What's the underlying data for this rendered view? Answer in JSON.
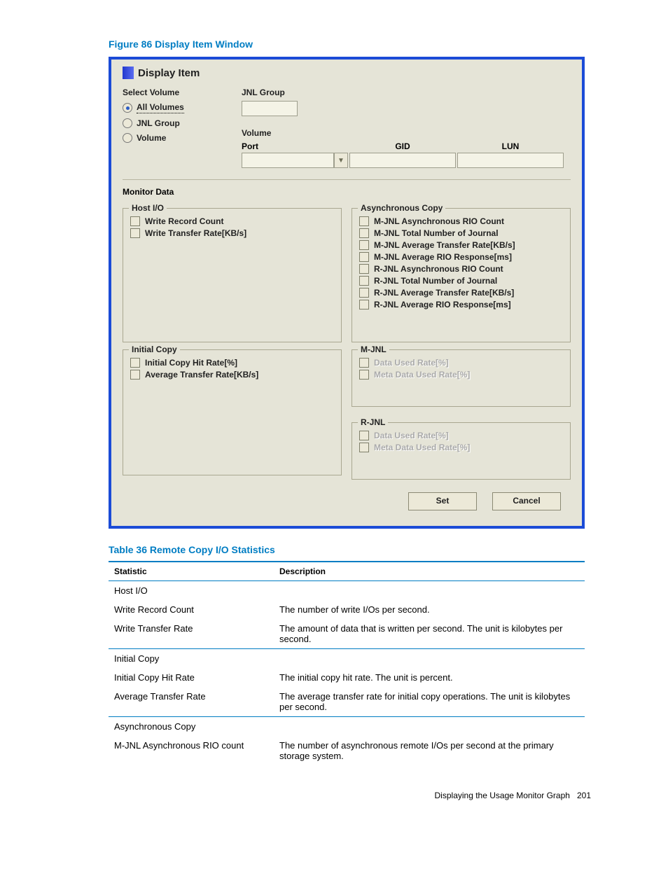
{
  "figure_title": "Figure 86 Display Item Window",
  "window": {
    "header": "Display Item",
    "select_volume_label": "Select Volume",
    "radio_all": "All Volumes",
    "radio_jnl": "JNL Group",
    "radio_vol": "Volume",
    "jnl_group_label": "JNL Group",
    "volume_label": "Volume",
    "port_label": "Port",
    "gid_label": "GID",
    "lun_label": "LUN",
    "monitor_label": "Monitor Data",
    "host_io": {
      "legend": "Host I/O",
      "items": [
        "Write Record Count",
        "Write Transfer Rate[KB/s]"
      ]
    },
    "async": {
      "legend": "Asynchronous Copy",
      "items": [
        "M-JNL Asynchronous RIO Count",
        "M-JNL Total Number of Journal",
        "M-JNL Average Transfer Rate[KB/s]",
        "M-JNL Average RIO Response[ms]",
        "R-JNL Asynchronous RIO Count",
        "R-JNL Total Number of Journal",
        "R-JNL Average Transfer Rate[KB/s]",
        "R-JNL Average RIO Response[ms]"
      ]
    },
    "initial": {
      "legend": "Initial Copy",
      "items": [
        "Initial Copy Hit Rate[%]",
        "Average Transfer Rate[KB/s]"
      ]
    },
    "mjnl": {
      "legend": "M-JNL",
      "items": [
        "Data Used Rate[%]",
        "Meta Data Used Rate[%]"
      ]
    },
    "rjnl": {
      "legend": "R-JNL",
      "items": [
        "Data Used Rate[%]",
        "Meta Data Used Rate[%]"
      ]
    },
    "set_btn": "Set",
    "cancel_btn": "Cancel"
  },
  "table_title": "Table 36 Remote Copy I/O Statistics",
  "table": {
    "col1": "Statistic",
    "col2": "Description",
    "rows": [
      {
        "s": "Host I/O",
        "d": "",
        "grp": true
      },
      {
        "s": "Write Record Count",
        "d": "The number of write I/Os per second."
      },
      {
        "s": "Write Transfer Rate",
        "d": "The amount of data that is written per second. The unit is kilobytes per second."
      },
      {
        "s": "Initial Copy",
        "d": "",
        "grp": true
      },
      {
        "s": "Initial Copy Hit Rate",
        "d": "The initial copy hit rate. The unit is percent."
      },
      {
        "s": "Average Transfer Rate",
        "d": "The average transfer rate for initial copy operations. The unit is kilobytes per second."
      },
      {
        "s": "Asynchronous Copy",
        "d": "",
        "grp": true
      },
      {
        "s": "M-JNL Asynchronous RIO count",
        "d": "The number of asynchronous remote I/Os per second at the primary storage system."
      }
    ]
  },
  "footer_text": "Displaying the Usage Monitor Graph",
  "footer_page": "201"
}
